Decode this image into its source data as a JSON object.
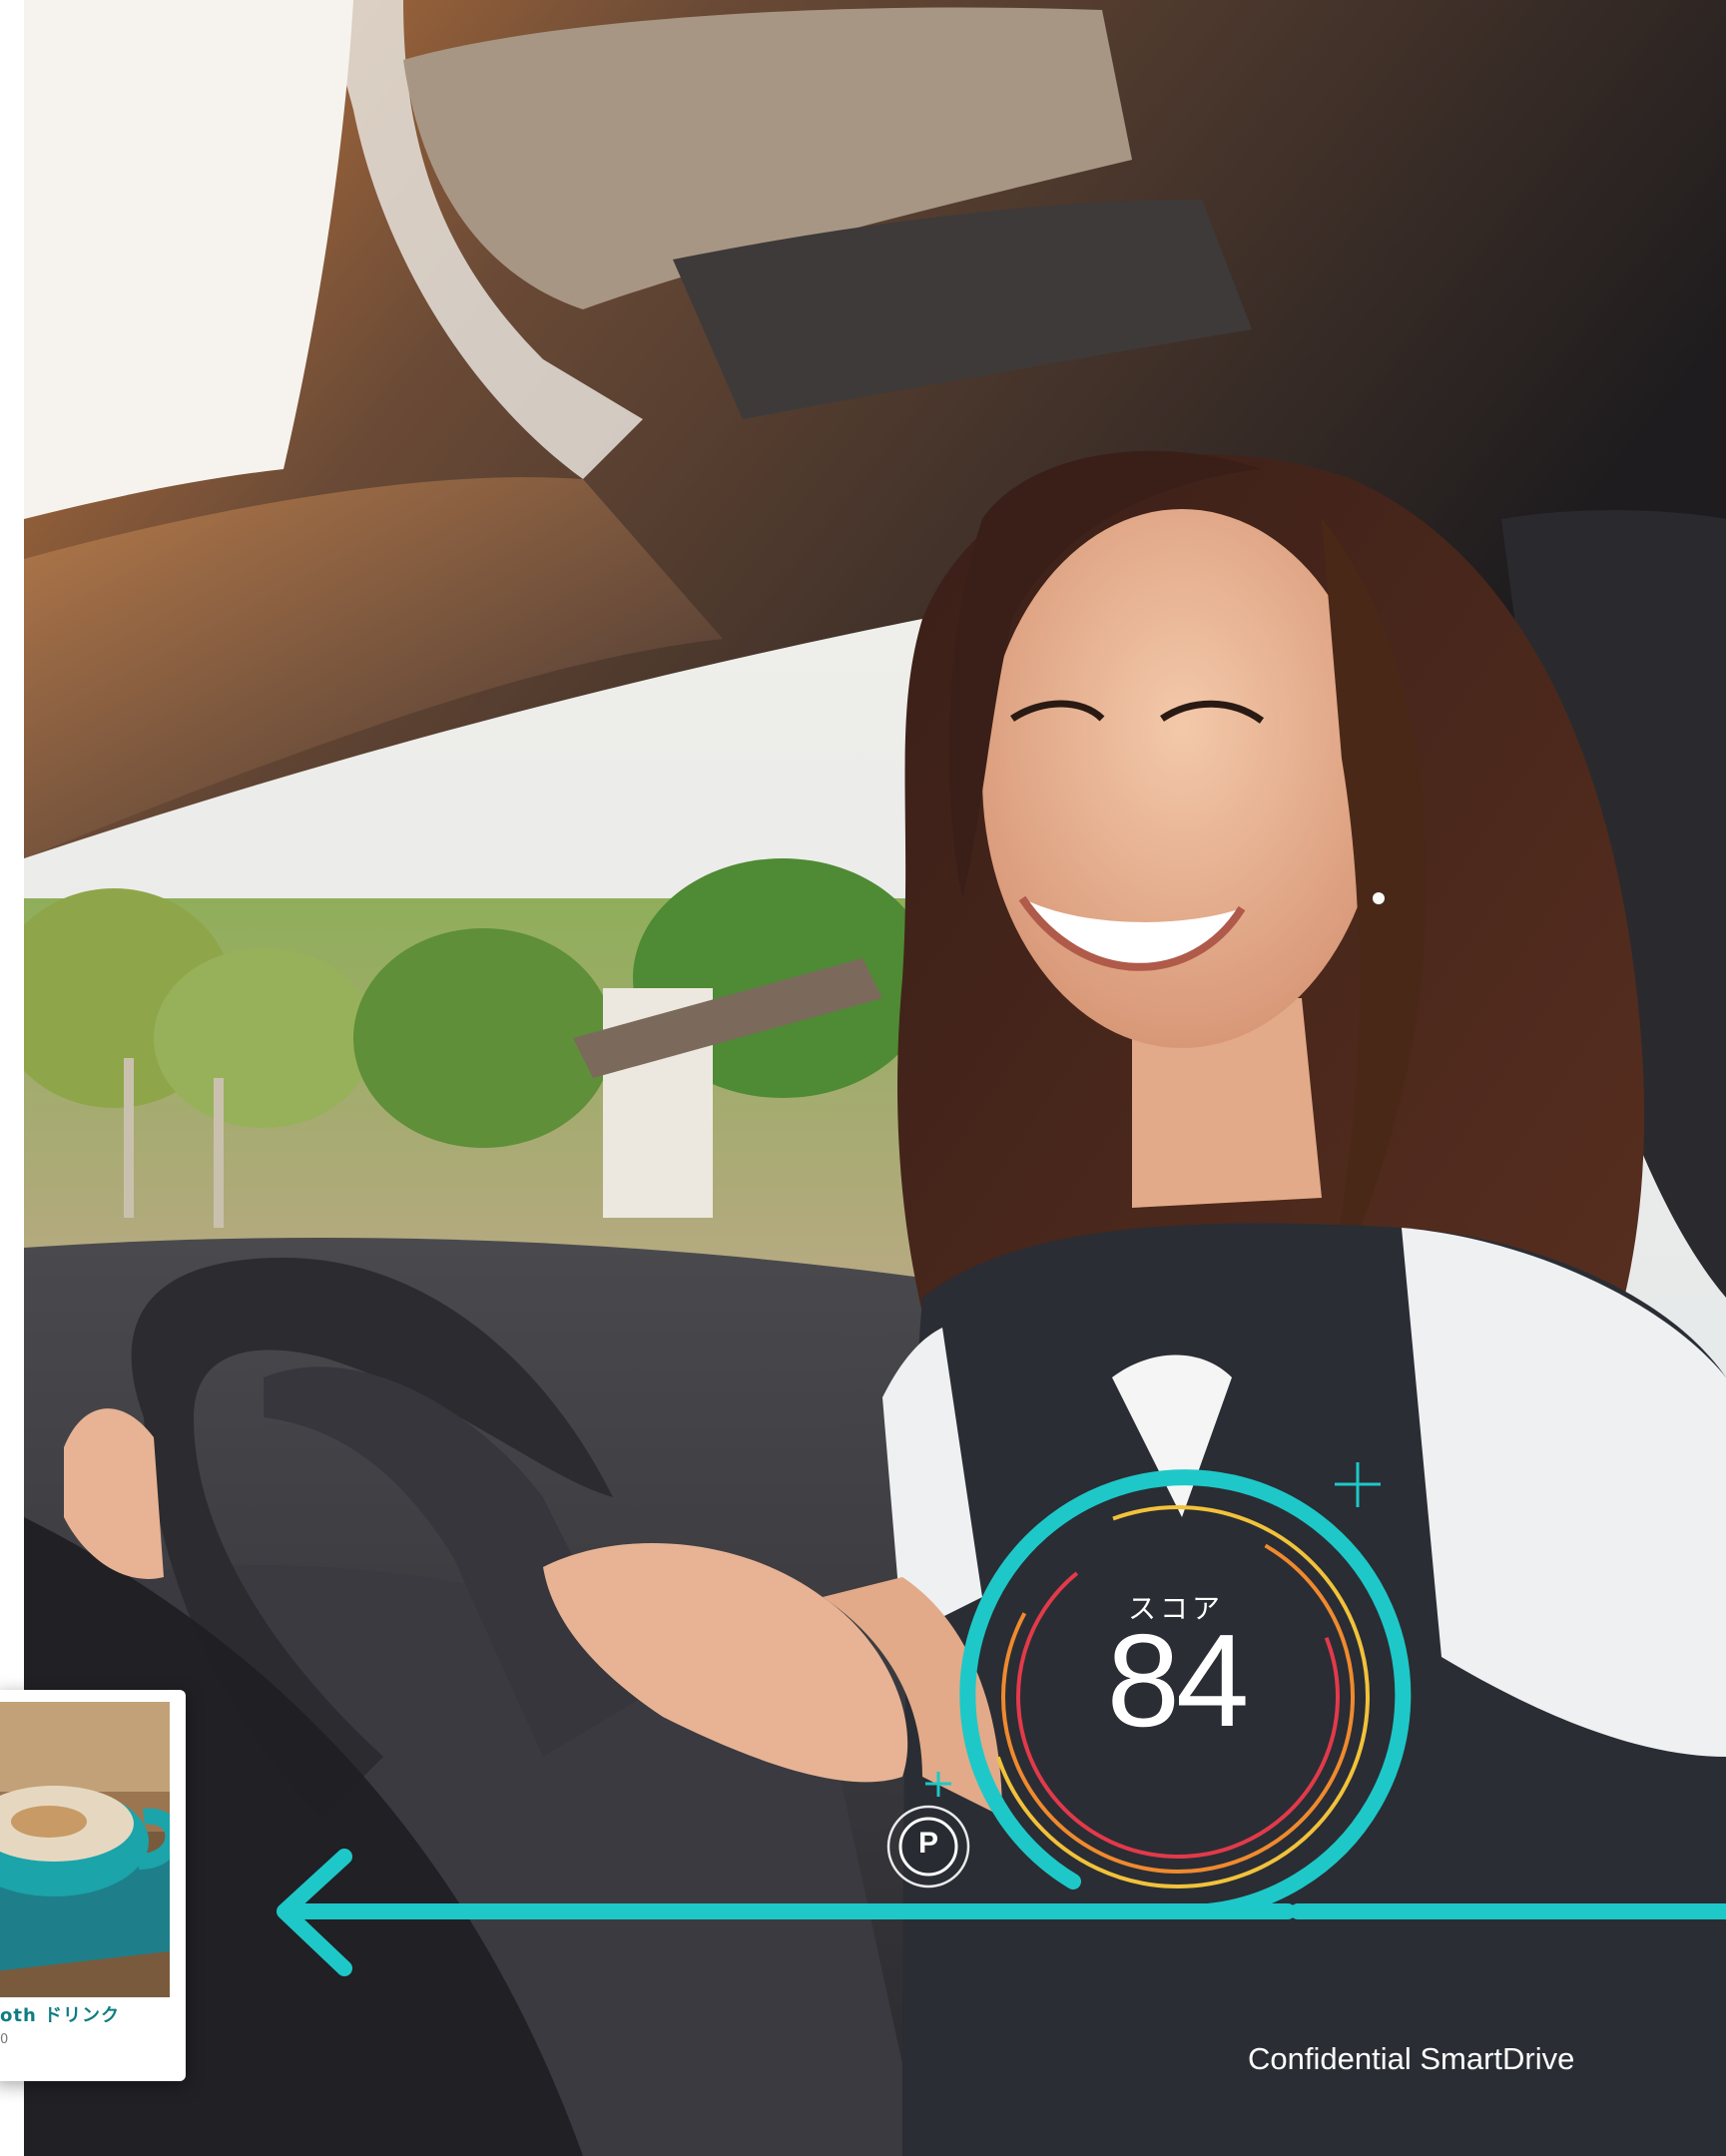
{
  "scene": {
    "description_icon": "smiling-driver-photo",
    "accent_color": "#1ec8c8"
  },
  "card": {
    "title": "oth ドリンク",
    "subtitle": "0",
    "image_icon": "coffee-cup-icon"
  },
  "score": {
    "label": "スコア",
    "value": "84"
  },
  "parking": {
    "letter": "P"
  },
  "footer": {
    "text": "Confidential SmartDrive"
  }
}
